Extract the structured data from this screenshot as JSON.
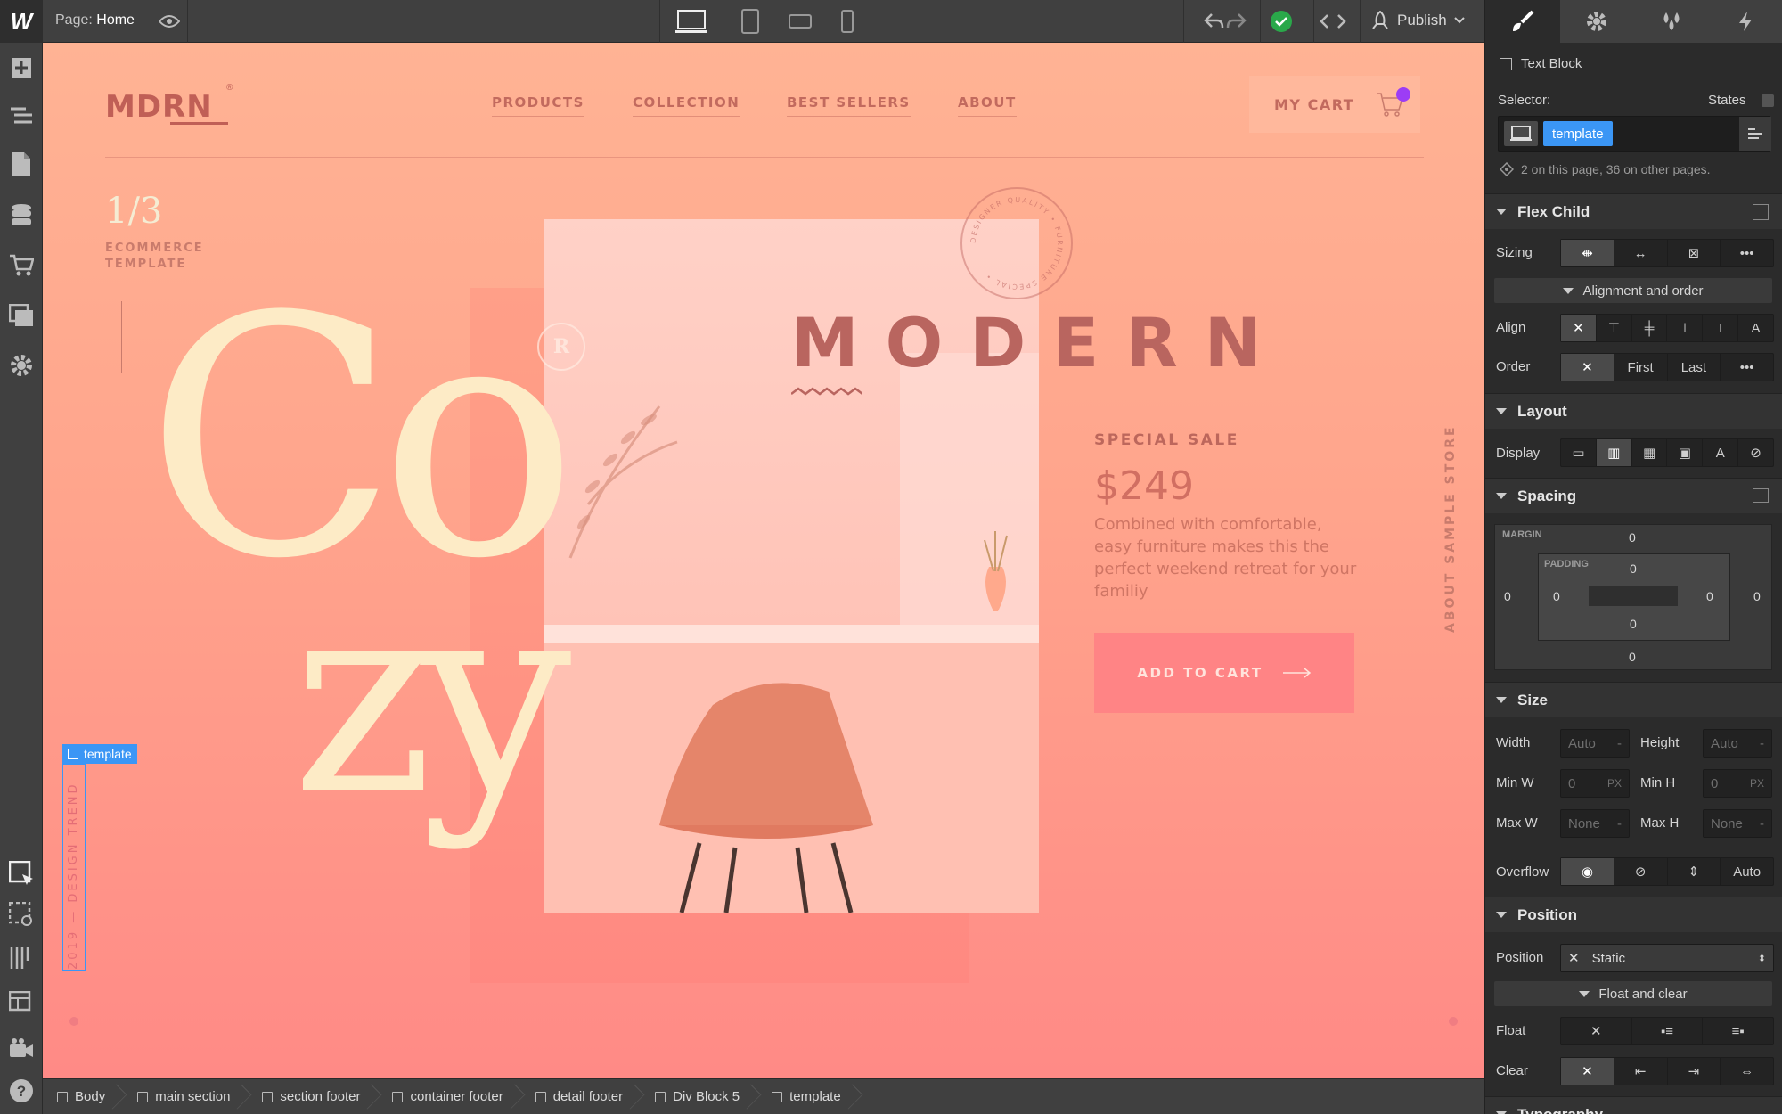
{
  "topbar": {
    "page_prefix": "Page:",
    "page_name": "Home",
    "publish_label": "Publish"
  },
  "canvas": {
    "logo": "MDRN",
    "logo_reg": "®",
    "nav": [
      "PRODUCTS",
      "COLLECTION",
      "BEST SELLERS",
      "ABOUT"
    ],
    "cart_label": "MY CART",
    "slide_counter": "1/3",
    "subtitle": "ECOMMERCE TEMPLATE",
    "headline_top": "Co",
    "headline_bottom": "zy",
    "badge_letter": "R",
    "heading": "MODERN",
    "sale_label": "SPECIAL SALE",
    "price": "$249",
    "description": "Combined with comfortable, easy furniture makes this the perfect weekend retreat for your familiy",
    "add_to_cart": "ADD TO CART",
    "vertical_right": "ABOUT SAMPLE STORE",
    "vertical_left": "2019 — DESIGN TREND",
    "selected_tag": "template",
    "stamp_text": "DESIGNER QUALITY • FURNITURE SPECIAL •"
  },
  "breadcrumb": [
    "Body",
    "main section",
    "section footer",
    "container footer",
    "detail footer",
    "Div Block 5",
    "template"
  ],
  "panel": {
    "element_type": "Text Block",
    "selector_label": "Selector:",
    "states_label": "States",
    "selector_chip": "template",
    "usage_note": "2 on this page, 36 on other pages.",
    "flex_child": {
      "title": "Flex Child",
      "sizing_label": "Sizing",
      "alignment_sub": "Alignment and order",
      "align_label": "Align",
      "order_label": "Order",
      "order_first": "First",
      "order_last": "Last"
    },
    "layout": {
      "title": "Layout",
      "display_label": "Display"
    },
    "spacing": {
      "title": "Spacing",
      "margin_label": "MARGIN",
      "padding_label": "PADDING",
      "margin": {
        "top": "0",
        "right": "0",
        "bottom": "0",
        "left": "0"
      },
      "padding": {
        "top": "0",
        "right": "0",
        "bottom": "0",
        "left": "0"
      }
    },
    "size": {
      "title": "Size",
      "width_label": "Width",
      "width_value": "Auto",
      "height_label": "Height",
      "height_value": "Auto",
      "minw_label": "Min W",
      "minw_value": "0",
      "minw_unit": "PX",
      "minh_label": "Min H",
      "minh_value": "0",
      "minh_unit": "PX",
      "maxw_label": "Max W",
      "maxw_value": "None",
      "maxh_label": "Max H",
      "maxh_value": "None",
      "overflow_label": "Overflow",
      "overflow_auto": "Auto"
    },
    "position": {
      "title": "Position",
      "position_label": "Position",
      "position_value": "Static",
      "float_sub": "Float and clear",
      "float_label": "Float",
      "clear_label": "Clear"
    },
    "typography_title": "Typography"
  },
  "colors": {
    "accent_blue": "#3b96f5",
    "success_green": "#2aa84a",
    "cart_dot": "#9c3df5",
    "canvas_top": "#ffb394",
    "canvas_bottom": "#ff8a86"
  }
}
